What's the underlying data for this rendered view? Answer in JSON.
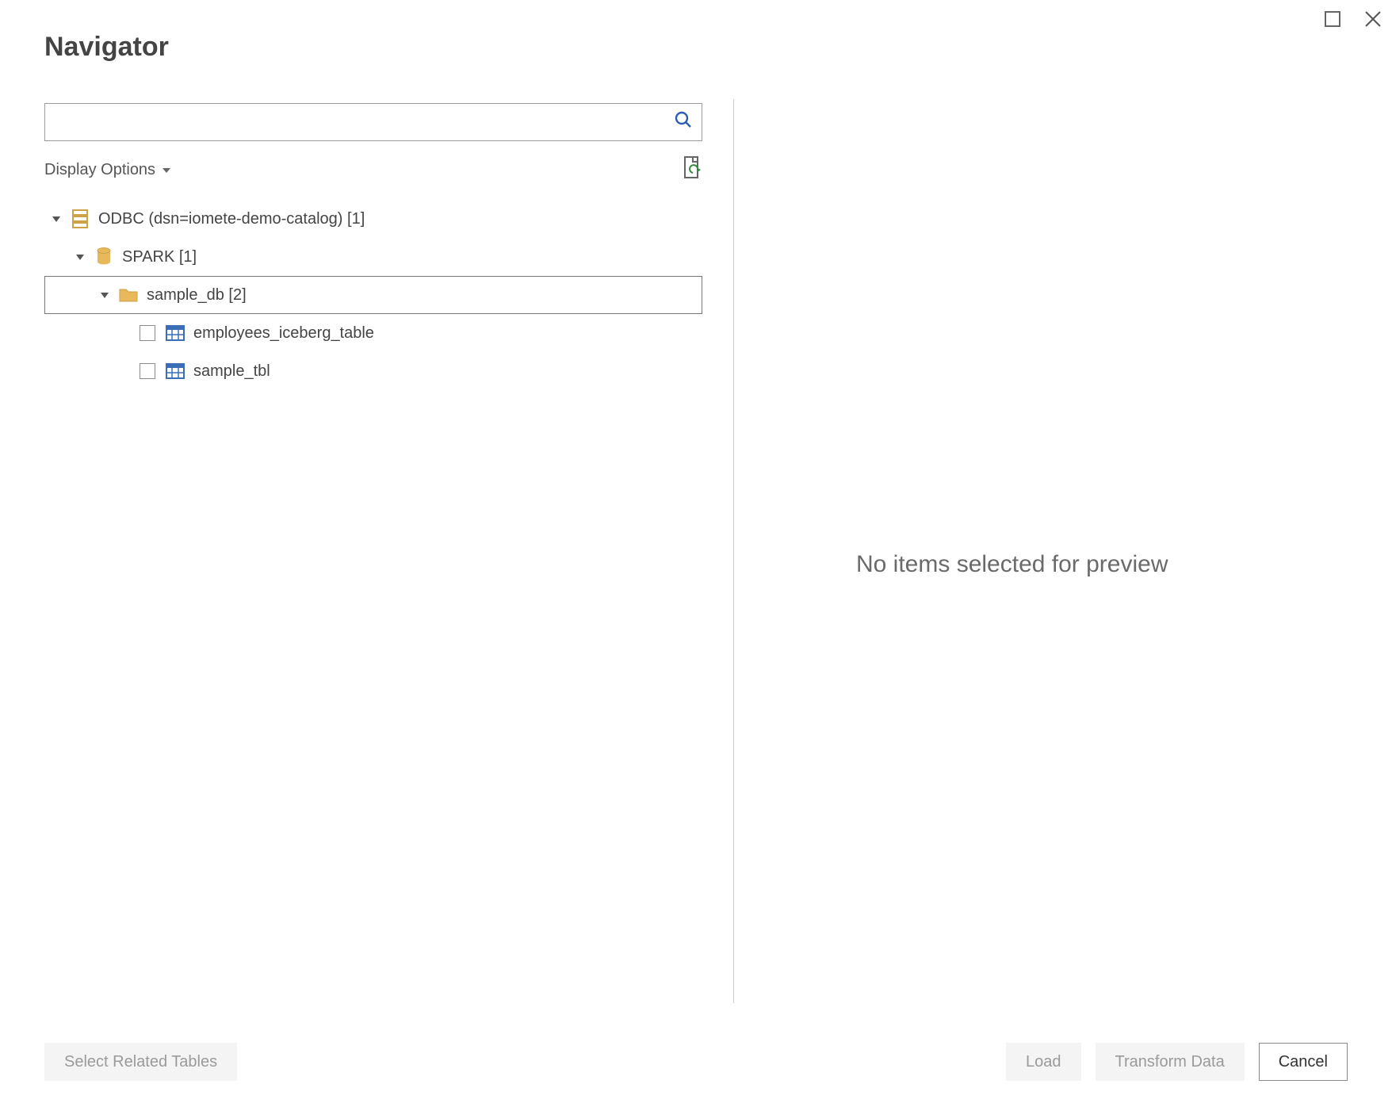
{
  "window": {
    "title": "Navigator"
  },
  "search": {
    "value": "",
    "placeholder": ""
  },
  "options": {
    "display_label": "Display Options"
  },
  "tree": {
    "root": {
      "label": "ODBC (dsn=iomete-demo-catalog) [1]",
      "children": {
        "spark": {
          "label": "SPARK [1]",
          "children": {
            "sample_db": {
              "label": "sample_db [2]",
              "selected": true,
              "tables": [
                {
                  "label": "employees_iceberg_table"
                },
                {
                  "label": "sample_tbl"
                }
              ]
            }
          }
        }
      }
    }
  },
  "preview": {
    "empty_text": "No items selected for preview"
  },
  "footer": {
    "select_related": "Select Related Tables",
    "load": "Load",
    "transform": "Transform Data",
    "cancel": "Cancel"
  }
}
